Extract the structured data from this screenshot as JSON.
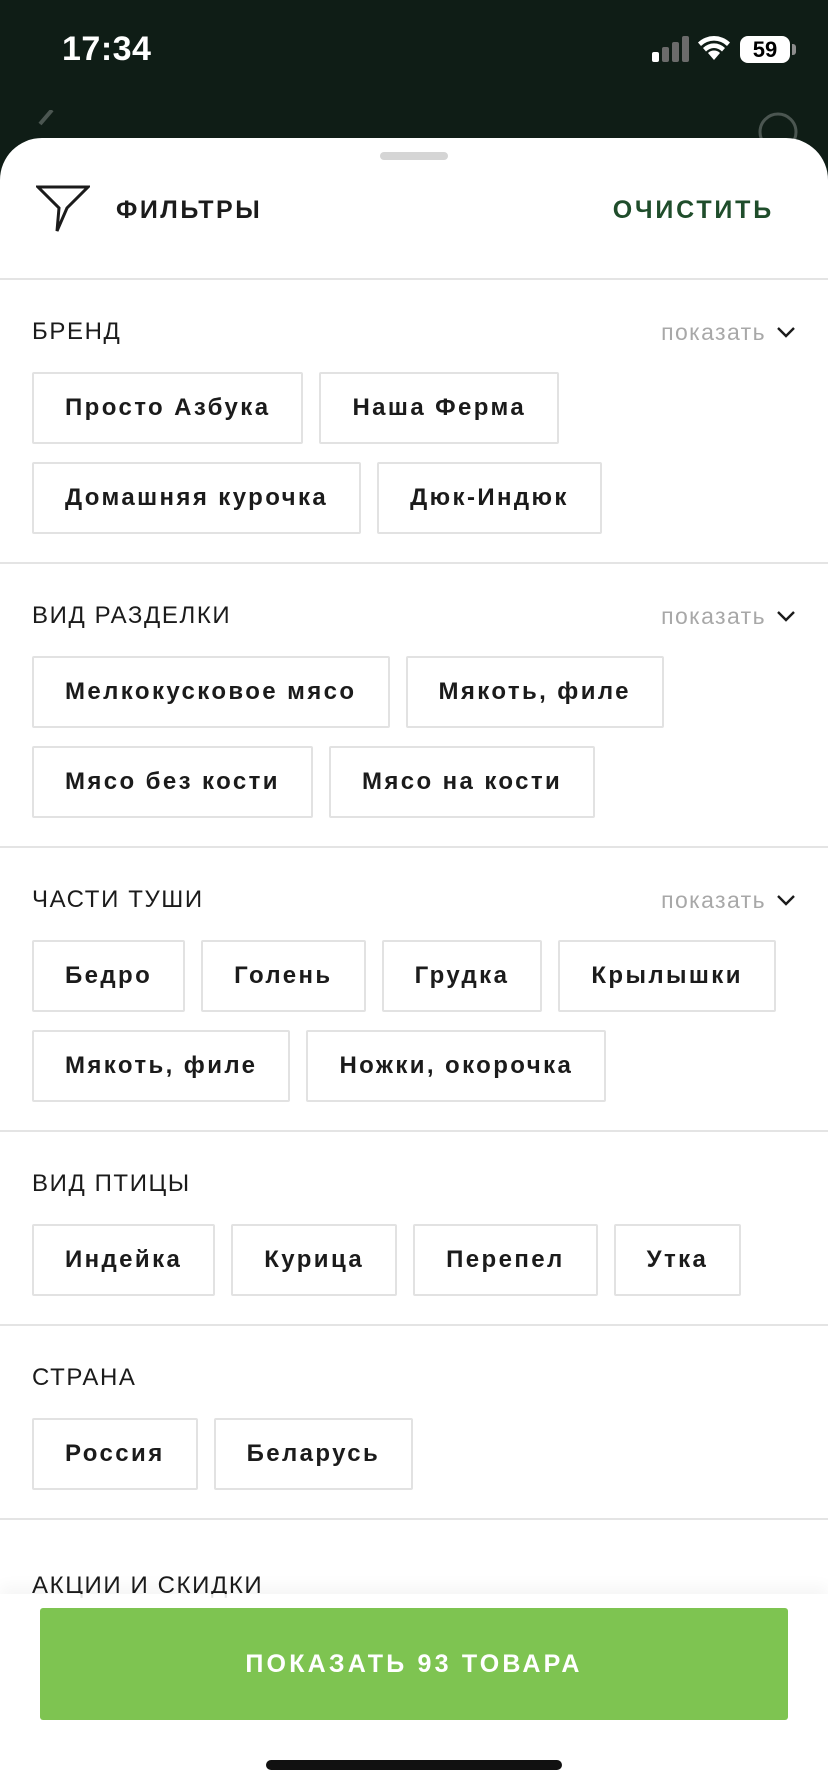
{
  "status_bar": {
    "time": "17:34",
    "battery": "59"
  },
  "header": {
    "title": "ФИЛЬТРЫ",
    "clear_label": "ОЧИСТИТЬ",
    "filter_icon": "funnel-icon"
  },
  "sections": [
    {
      "title": "БРЕНД",
      "show_label": "показать",
      "chips": [
        "Просто Азбука",
        "Наша Ферма",
        "Домашняя курочка",
        "Дюк-Индюк"
      ]
    },
    {
      "title": "ВИД РАЗДЕЛКИ",
      "show_label": "показать",
      "chips": [
        "Мелкокусковое мясо",
        "Мякоть, филе",
        "Мясо без кости",
        "Мясо на кости"
      ]
    },
    {
      "title": "ЧАСТИ ТУШИ",
      "show_label": "показать",
      "chips": [
        "Бедро",
        "Голень",
        "Грудка",
        "Крылышки",
        "Мякоть, филе",
        "Ножки, окорочка"
      ]
    },
    {
      "title": "ВИД ПТИЦЫ",
      "chips": [
        "Индейка",
        "Курица",
        "Перепел",
        "Утка"
      ]
    },
    {
      "title": "СТРАНА",
      "chips": [
        "Россия",
        "Беларусь"
      ]
    }
  ],
  "peek_section_title": "АКЦИИ И СКИДКИ",
  "apply_button_label": "ПОКАЗАТЬ 93 ТОВАРА",
  "colors": {
    "accent_green": "#7ec451",
    "clear_text": "#1f4d2b",
    "backdrop": "#0f1d16"
  }
}
